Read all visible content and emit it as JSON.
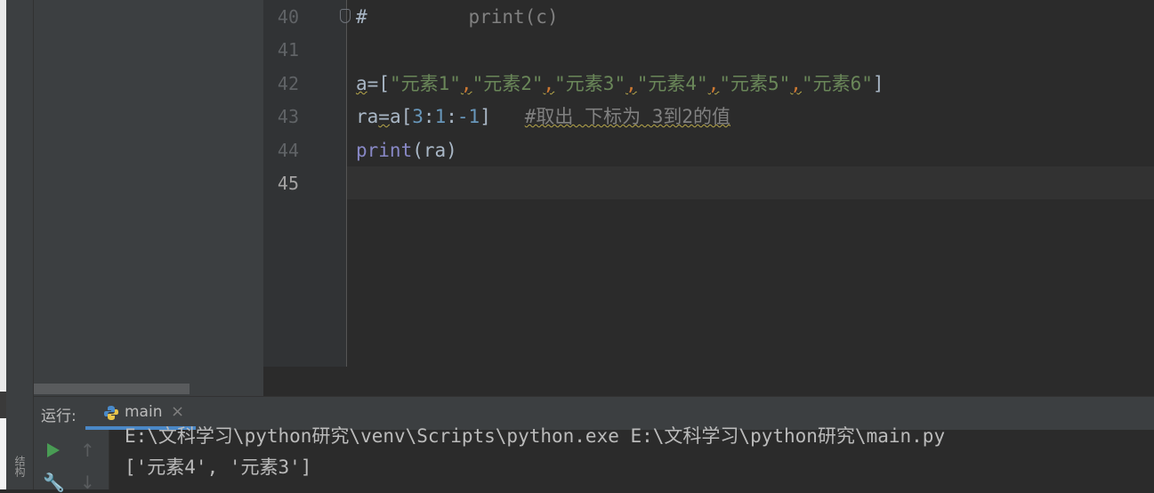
{
  "side_strip": {
    "label": "结构"
  },
  "editor": {
    "lines": [
      {
        "number": "40",
        "comment_hash": "#",
        "text": "         print(c)"
      },
      {
        "number": "41"
      },
      {
        "number": "42",
        "var": "a",
        "op": "=",
        "open": "[",
        "items": [
          "\"元素1\"",
          "\"元素2\"",
          "\"元素3\"",
          "\"元素4\"",
          "\"元素5\"",
          "\"元素6\""
        ],
        "close": "]",
        "separator": ","
      },
      {
        "number": "43",
        "var": "ra",
        "op": "=",
        "obj": "a",
        "open": "[",
        "start": "3",
        "colon": ":",
        "stop": "1",
        "step": "-1",
        "close": "]",
        "comment": "#取出 下标为 3到2的值"
      },
      {
        "number": "44",
        "fn": "print",
        "args": "(ra)"
      },
      {
        "number": "45"
      }
    ]
  },
  "run_panel": {
    "label": "运行:",
    "tab_label": "main",
    "tab_close": "×",
    "output": [
      "E:\\文科学习\\python研究\\venv\\Scripts\\python.exe E:\\文科学习\\python研究\\main.py",
      "['元素4', '元素3']"
    ]
  },
  "icons": [
    "fold-marker-icon",
    "python-icon",
    "run-icon",
    "up-arrow-icon",
    "wrench-icon",
    "down-arrow-icon",
    "close-icon"
  ],
  "colors": {
    "background": "#2b2b2b",
    "panel": "#3c3f41",
    "string": "#6a8759",
    "number": "#6897bb",
    "comment": "#808080",
    "builtin": "#8888c6",
    "keyword_sep": "#cc7832",
    "run_green": "#499c54"
  }
}
